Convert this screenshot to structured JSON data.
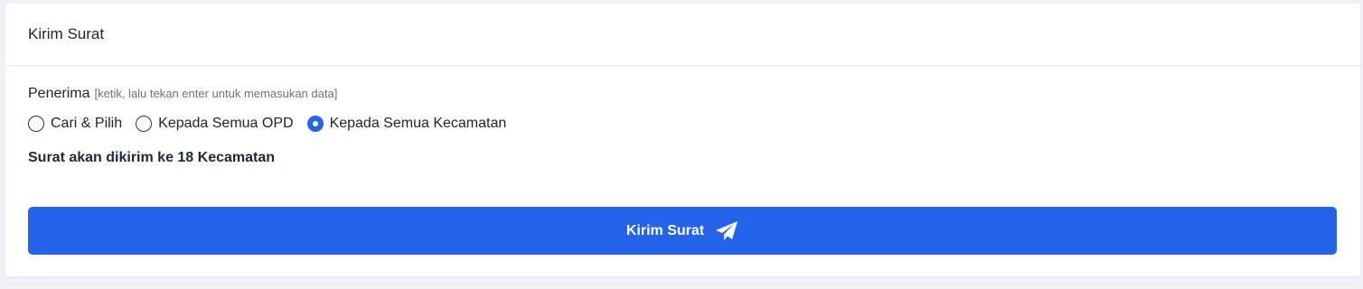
{
  "card": {
    "title": "Kirim Surat"
  },
  "recipient": {
    "label": "Penerima",
    "hint": "[ketik, lalu tekan enter untuk memasukan data]",
    "options": [
      {
        "label": "Cari & Pilih",
        "checked": false
      },
      {
        "label": "Kepada Semua OPD",
        "checked": false
      },
      {
        "label": "Kepada Semua Kecamatan",
        "checked": true
      }
    ],
    "summary": "Surat akan dikirim ke 18 Kecamatan"
  },
  "submit": {
    "label": "Kirim Surat",
    "icon": "paper-plane-icon"
  },
  "colors": {
    "primary": "#2563eb",
    "page_background": "#eef1f6"
  }
}
